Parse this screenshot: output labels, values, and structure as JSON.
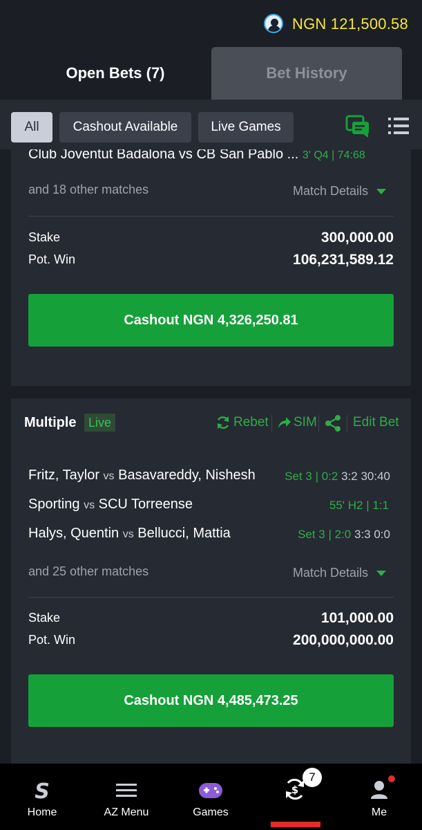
{
  "header": {
    "balance": "NGN 121,500.58",
    "avatar_icon": "user-avatar-icon"
  },
  "tabs": [
    {
      "label": "Open Bets (7)",
      "active": true
    },
    {
      "label": "Bet History",
      "active": false
    }
  ],
  "filters": [
    {
      "label": "All",
      "selected": true
    },
    {
      "label": "Cashout Available",
      "selected": false
    },
    {
      "label": "Live Games",
      "selected": false
    }
  ],
  "toolbar_icons": [
    "chat-icon",
    "list-view-icon"
  ],
  "card1": {
    "cut_match": "Club Joventut Badalona vs CB San Pablo ...",
    "cut_score": "3' Q4 | 74:68",
    "others": "and 18 other matches",
    "details_label": "Match Details",
    "stake_label": "Stake",
    "stake_value": "300,000.00",
    "potwin_label": "Pot. Win",
    "potwin_value": "106,231,589.12",
    "cashout_label": "Cashout NGN 4,326,250.81"
  },
  "card2": {
    "bet_type": "Multiple",
    "live_label": "Live",
    "actions": {
      "rebet": "Rebet",
      "sim": "SIM",
      "edit": "Edit Bet"
    },
    "matches": [
      {
        "home": "Fritz, Taylor",
        "vs": "vs",
        "away": "Basavareddy, Nishesh",
        "status": "Set 3 | 0:2",
        "extra": "3:2 30:40"
      },
      {
        "home": "Sporting",
        "vs": "vs",
        "away": "SCU Torreense",
        "status": "55' H2 | 1:1",
        "extra": ""
      },
      {
        "home": "Halys, Quentin",
        "vs": "vs",
        "away": "Bellucci, Mattia",
        "status": "Set 3 | 2:0",
        "extra": "3:3 0:0"
      }
    ],
    "others": "and 25 other matches",
    "details_label": "Match Details",
    "stake_label": "Stake",
    "stake_value": "101,000.00",
    "potwin_label": "Pot. Win",
    "potwin_value": "200,000,000.00",
    "cashout_label": "Cashout NGN 4,485,473.25"
  },
  "bottom_nav": [
    {
      "label": "Home",
      "icon": "sporty-logo-icon"
    },
    {
      "label": "AZ Menu",
      "icon": "hamburger-menu-icon"
    },
    {
      "label": "Games",
      "icon": "gamepad-icon"
    },
    {
      "label": "",
      "icon": "cashout-bets-icon",
      "badge": "7",
      "active": true
    },
    {
      "label": "Me",
      "icon": "profile-icon"
    }
  ],
  "colors": {
    "accent_green": "#16a03a",
    "balance_yellow": "#f4e83a",
    "background": "#1b1e25",
    "card": "#262a33",
    "active_red": "#e32b2b"
  }
}
